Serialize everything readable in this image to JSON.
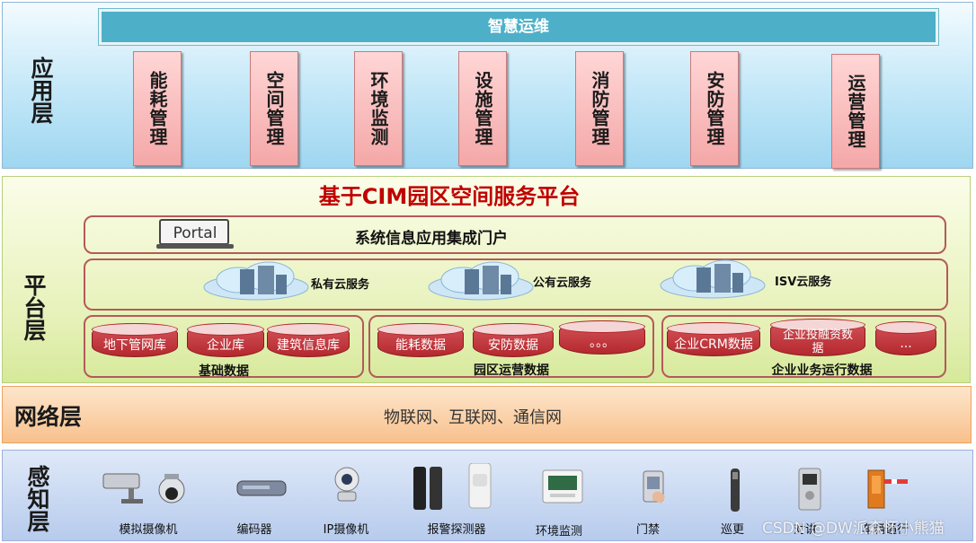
{
  "layers": {
    "app": "应用层",
    "platform": "平台层",
    "network": "网络层",
    "sense": "感知层"
  },
  "app": {
    "bar_title": "智慧运维",
    "modules": [
      "能耗管理",
      "空间管理",
      "环境监测",
      "设施管理",
      "消防管理",
      "安防管理",
      "运营管理"
    ]
  },
  "platform": {
    "title": "基于CIM园区空间服务平台",
    "portal_label": "Portal",
    "portal_title": "系统信息应用集成门户",
    "clouds": [
      "私有云服务",
      "公有云服务",
      "ISV云服务"
    ],
    "groups": [
      {
        "label": "基础数据",
        "items": [
          "地下管网库",
          "企业库",
          "建筑信息库"
        ]
      },
      {
        "label": "园区运营数据",
        "items": [
          "能耗数据",
          "安防数据",
          "。。。"
        ]
      },
      {
        "label": "企业业务运行数据",
        "items": [
          "企业CRM数据",
          "企业投融资数据",
          "..."
        ]
      }
    ]
  },
  "network": {
    "text": "物联网、互联网、通信网"
  },
  "sense": {
    "devices": [
      "模拟摄像机",
      "编码器",
      "IP摄像机",
      "报警探测器",
      "环境监测",
      "门禁",
      "巡更",
      "对讲",
      "车辆通行"
    ]
  },
  "watermark": "CSDN @DW派森怀小熊猫",
  "colors": {
    "title_red": "#c00000",
    "module_pink": "#f4a7a7",
    "bar_teal": "#4eb0c8",
    "db_red": "#b4282e"
  }
}
